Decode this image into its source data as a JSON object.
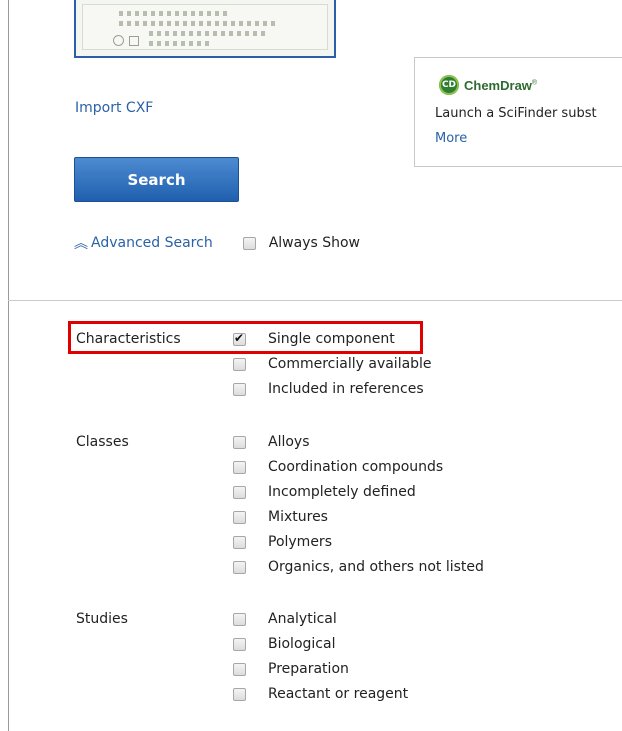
{
  "import_link": "Import CXF",
  "search_button": "Search",
  "advanced_search": {
    "icon": "double-chevron-up-icon",
    "label": "Advanced Search",
    "always_show_label": "Always Show",
    "always_show_checked": false
  },
  "promo": {
    "logo_icon_text": "CD",
    "brand": "ChemDraw",
    "text": "Launch a SciFinder subst",
    "more_link": "More"
  },
  "filters": {
    "characteristics": {
      "label": "Characteristics",
      "options": [
        {
          "label": "Single component",
          "checked": true
        },
        {
          "label": "Commercially available",
          "checked": false
        },
        {
          "label": "Included in references",
          "checked": false
        }
      ]
    },
    "classes": {
      "label": "Classes",
      "options": [
        {
          "label": "Alloys",
          "checked": false
        },
        {
          "label": "Coordination compounds",
          "checked": false
        },
        {
          "label": "Incompletely defined",
          "checked": false
        },
        {
          "label": "Mixtures",
          "checked": false
        },
        {
          "label": "Polymers",
          "checked": false
        },
        {
          "label": "Organics, and others not listed",
          "checked": false
        }
      ]
    },
    "studies": {
      "label": "Studies",
      "options": [
        {
          "label": "Analytical",
          "checked": false
        },
        {
          "label": "Biological",
          "checked": false
        },
        {
          "label": "Preparation",
          "checked": false
        },
        {
          "label": "Reactant or reagent",
          "checked": false
        }
      ]
    }
  },
  "colors": {
    "link": "#2a62a8",
    "button": "#1f5fae",
    "highlight": "#e00000"
  }
}
